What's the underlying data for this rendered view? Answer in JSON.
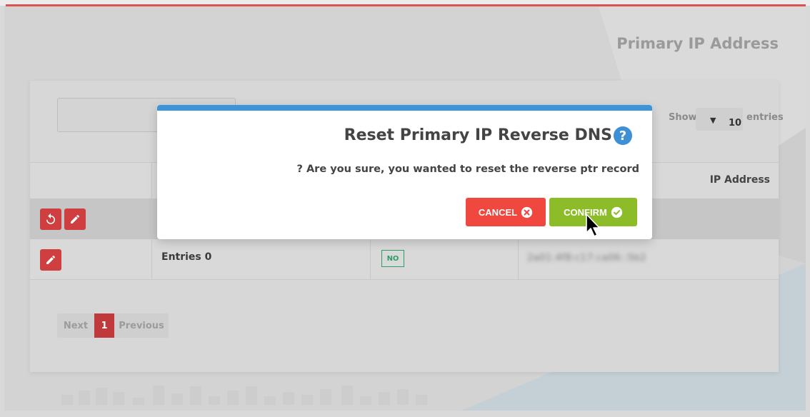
{
  "page": {
    "title": "Primary IP Address"
  },
  "table": {
    "search_value": "",
    "show_label": "Show",
    "page_length": "10",
    "entries_label": "entries",
    "columns": [
      "",
      "",
      "",
      "IP Address"
    ],
    "rows": [
      {
        "actions": [
          "reset-icon",
          "pencil-icon"
        ],
        "name": "",
        "status": "",
        "ip": ""
      },
      {
        "actions": [
          "pencil-icon"
        ],
        "name": "Entries 0",
        "status": "NO",
        "ip": "2a01:4f8:c17:ca06::5b2"
      }
    ]
  },
  "pagination": {
    "next_label": "Next",
    "current_page": "1",
    "previous_label": "Previous"
  },
  "modal": {
    "title": "Reset Primary IP Reverse DNS",
    "message": "? Are you sure, you wanted to reset the reverse ptr record",
    "cancel_label": "CANCEL",
    "confirm_label": "CONFIRM"
  },
  "colors": {
    "accent_red": "#d9534f",
    "modal_top": "#3d95d9",
    "cancel": "#f0473f",
    "confirm": "#8cbd28",
    "badge_green": "#2e9e66"
  }
}
